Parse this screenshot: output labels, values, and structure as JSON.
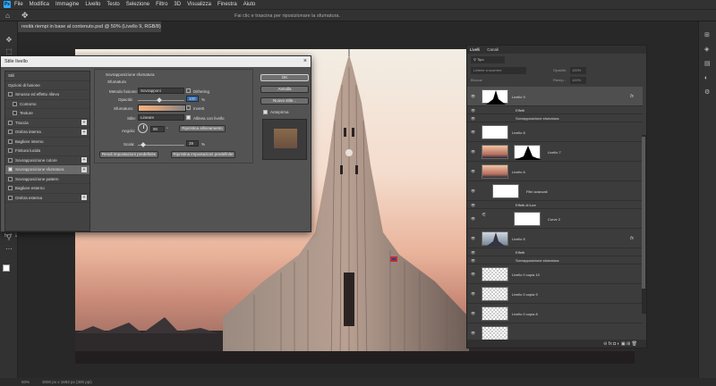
{
  "menu": {
    "app_badge": "Ps",
    "items": [
      "File",
      "Modifica",
      "Immagine",
      "Livello",
      "Testo",
      "Selezione",
      "Filtro",
      "3D",
      "Visualizza",
      "Finestra",
      "Aiuto"
    ]
  },
  "options_bar": {
    "hint": "Fai clic e trascina per riposizionare la sfumatura."
  },
  "document_tab": {
    "title": "resità riempi in base al contenuto.psd @ 50% (Livello 9, RGB/8) *"
  },
  "status": {
    "zoom": "50%",
    "info": "3000 px x 1693 px (300 ppi)"
  },
  "dialog": {
    "title": "Stile livello",
    "close": "×",
    "list": [
      {
        "label": "Stili",
        "check": null,
        "plus": false,
        "indent": false,
        "selected": false
      },
      {
        "label": "Opzioni di fusione",
        "check": null,
        "plus": false,
        "indent": false,
        "selected": false
      },
      {
        "label": "Smusso ed effetto rilievo",
        "check": false,
        "plus": false,
        "indent": false,
        "selected": false
      },
      {
        "label": "Contorno",
        "check": false,
        "plus": false,
        "indent": true,
        "selected": false
      },
      {
        "label": "Texture",
        "check": false,
        "plus": false,
        "indent": true,
        "selected": false
      },
      {
        "label": "Traccia",
        "check": false,
        "plus": true,
        "indent": false,
        "selected": false
      },
      {
        "label": "Ombra interna",
        "check": false,
        "plus": true,
        "indent": false,
        "selected": false
      },
      {
        "label": "Bagliore interno",
        "check": false,
        "plus": false,
        "indent": false,
        "selected": false
      },
      {
        "label": "Finitura lucida",
        "check": false,
        "plus": false,
        "indent": false,
        "selected": false
      },
      {
        "label": "Sovrapposizione colore",
        "check": false,
        "plus": true,
        "indent": false,
        "selected": false
      },
      {
        "label": "Sovrapposizione sfumatura",
        "check": true,
        "plus": true,
        "indent": false,
        "selected": true
      },
      {
        "label": "Sovrapposizione pattern",
        "check": false,
        "plus": false,
        "indent": false,
        "selected": false
      },
      {
        "label": "Bagliore esterno",
        "check": false,
        "plus": false,
        "indent": false,
        "selected": false
      },
      {
        "label": "Ombra esterna",
        "check": false,
        "plus": true,
        "indent": false,
        "selected": false
      }
    ],
    "footer_icons": "fx  ⇡  ⇣",
    "section_title": "Sovrapposizione sfumatura",
    "subsection": "Sfumatura",
    "blend_label": "Metodo fusione:",
    "blend_value": "Sovrapponi",
    "dither_label": "Dithering",
    "opacity_label": "Opacità:",
    "opacity_value": "100",
    "percent": "%",
    "gradient_label": "Sfumatura:",
    "reverse_label": "Inverti",
    "style_label": "Stile:",
    "style_value": "Lineare",
    "align_label": "Allinea con livello",
    "angle_label": "Angolo:",
    "angle_value": "90",
    "degree": "°",
    "reset_align": "Ripristina allineamento",
    "scale_label": "Scala:",
    "scale_value": "39",
    "make_default": "Rendi impostazioni predefinite",
    "reset_default": "Ripristina impostazioni predefinite",
    "ok": "OK",
    "cancel": "Annulla",
    "new_style": "Nuovo stile...",
    "preview_label": "Anteprima",
    "preview_color": "#8a6a4c"
  },
  "layers": {
    "tabs": [
      "Livelli",
      "Canali"
    ],
    "kind_label": "Tipo",
    "blend_mode": "Lettere a scorrere",
    "opacity_label": "Opacità:",
    "opacity_value": "100%",
    "lock_label": "Blocca:",
    "fill_label": "Riemp.:",
    "fill_value": "100%",
    "rows": [
      {
        "name": "Livello 9",
        "kind": "gradient-sel",
        "fx": "fx"
      },
      {
        "name": "Effetti",
        "kind": "effect"
      },
      {
        "name": "Sovrapposizione sfumatura",
        "kind": "subeffect"
      },
      {
        "name": "Livello 8",
        "kind": "white"
      },
      {
        "name": "Livello 7",
        "kind": "photo-mask"
      },
      {
        "name": "Livello 6",
        "kind": "photo"
      },
      {
        "name": "Filtri avanzati",
        "kind": "smartfilter"
      },
      {
        "name": "Effetti di luce",
        "kind": "subeffect"
      },
      {
        "name": "Curve 2",
        "kind": "adjust"
      },
      {
        "name": "Livello 5",
        "kind": "tower",
        "fx": "fx"
      },
      {
        "name": "Effetti",
        "kind": "effect"
      },
      {
        "name": "Sovrapposizione sfumatura",
        "kind": "subeffect"
      },
      {
        "name": "Livello 0 copia 10",
        "kind": "checker"
      },
      {
        "name": "Livello 0 copia 9",
        "kind": "checker"
      },
      {
        "name": "Livello 0 copia 8",
        "kind": "checker"
      },
      {
        "name": "",
        "kind": "checker"
      }
    ],
    "footer": "⊝ fx ◘ ◐ ▣ ⊞ 🗑"
  },
  "colors": {
    "accent": "#31a8ff",
    "sky_top": "#f3ede3",
    "sky_bottom": "#c98a78"
  }
}
